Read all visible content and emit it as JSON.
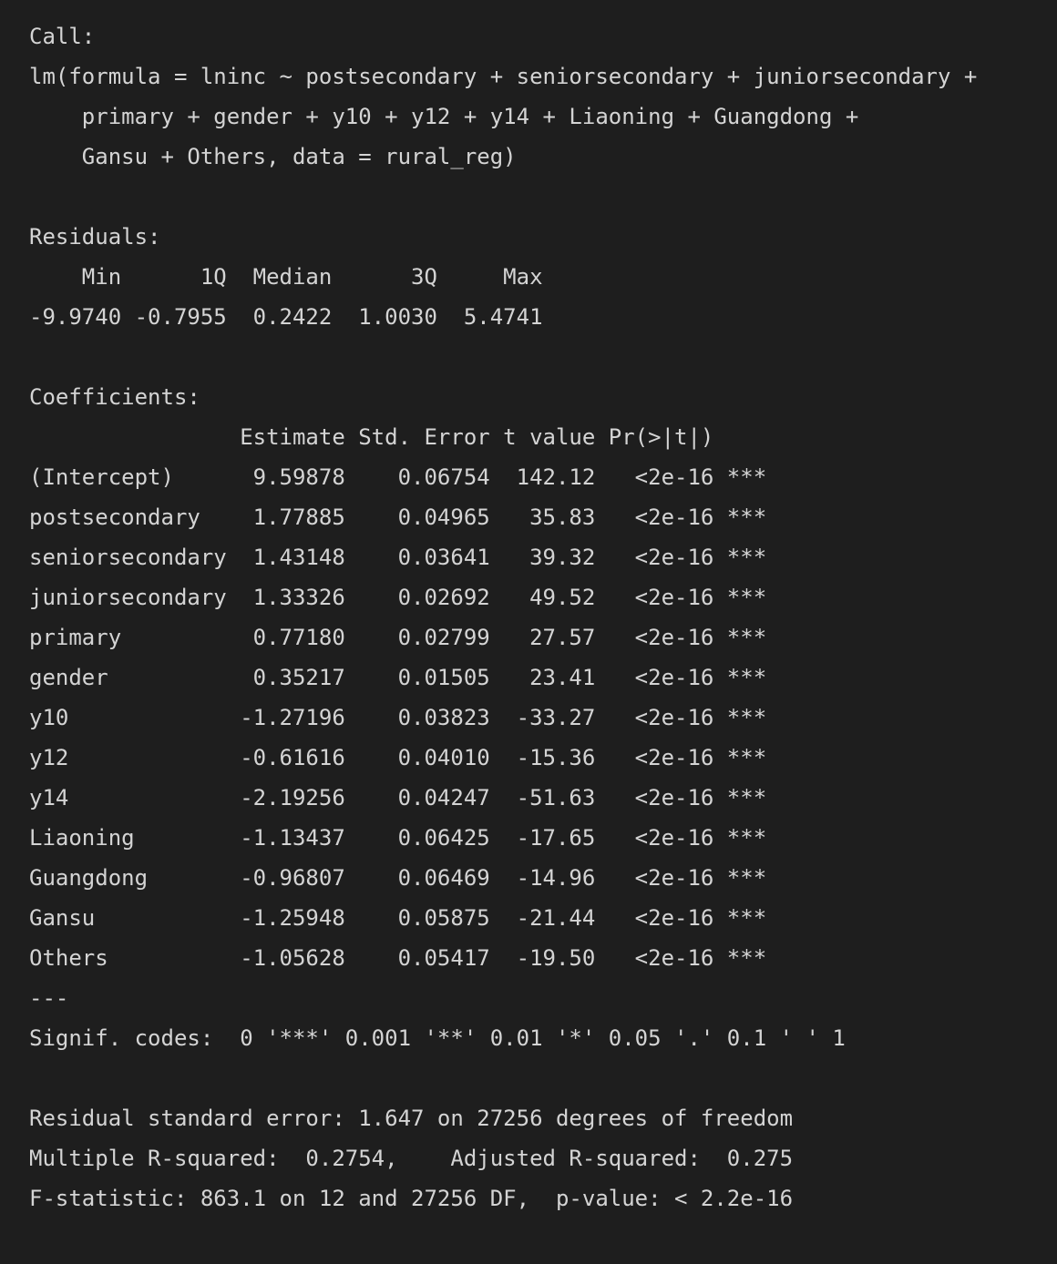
{
  "output_lines": [
    "Call:",
    "lm(formula = lninc ~ postsecondary + seniorsecondary + juniorsecondary +",
    "    primary + gender + y10 + y12 + y14 + Liaoning + Guangdong +",
    "    Gansu + Others, data = rural_reg)",
    "",
    "Residuals:",
    "    Min      1Q  Median      3Q     Max",
    "-9.9740 -0.7955  0.2422  1.0030  5.4741",
    "",
    "Coefficients:",
    "                Estimate Std. Error t value Pr(>|t|)",
    "(Intercept)      9.59878    0.06754  142.12   <2e-16 ***",
    "postsecondary    1.77885    0.04965   35.83   <2e-16 ***",
    "seniorsecondary  1.43148    0.03641   39.32   <2e-16 ***",
    "juniorsecondary  1.33326    0.02692   49.52   <2e-16 ***",
    "primary          0.77180    0.02799   27.57   <2e-16 ***",
    "gender           0.35217    0.01505   23.41   <2e-16 ***",
    "y10             -1.27196    0.03823  -33.27   <2e-16 ***",
    "y12             -0.61616    0.04010  -15.36   <2e-16 ***",
    "y14             -2.19256    0.04247  -51.63   <2e-16 ***",
    "Liaoning        -1.13437    0.06425  -17.65   <2e-16 ***",
    "Guangdong       -0.96807    0.06469  -14.96   <2e-16 ***",
    "Gansu           -1.25948    0.05875  -21.44   <2e-16 ***",
    "Others          -1.05628    0.05417  -19.50   <2e-16 ***",
    "---",
    "Signif. codes:  0 '***' 0.001 '**' 0.01 '*' 0.05 '.' 0.1 ' ' 1",
    "",
    "Residual standard error: 1.647 on 27256 degrees of freedom",
    "Multiple R-squared:  0.2754,    Adjusted R-squared:  0.275",
    "F-statistic: 863.1 on 12 and 27256 DF,  p-value: < 2.2e-16"
  ],
  "colors": {
    "background": "#1e1e1e",
    "text": "#d4d4d4"
  }
}
